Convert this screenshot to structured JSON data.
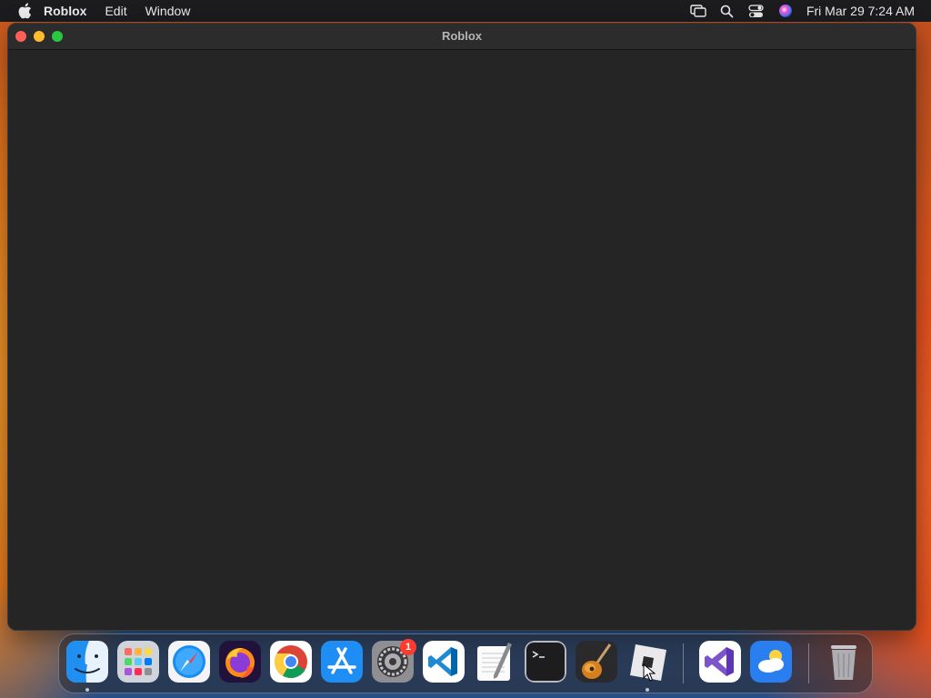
{
  "menubar": {
    "app_name": "Roblox",
    "items": [
      "Edit",
      "Window"
    ],
    "clock": "Fri Mar 29  7:24 AM",
    "status_icons": [
      "screen-mirroring-icon",
      "search-icon",
      "control-center-icon",
      "siri-icon"
    ]
  },
  "window": {
    "title": "Roblox"
  },
  "dock": {
    "apps": [
      {
        "name": "Finder",
        "icon": "finder-icon",
        "running": true
      },
      {
        "name": "Launchpad",
        "icon": "launchpad-icon",
        "running": false
      },
      {
        "name": "Safari",
        "icon": "safari-icon",
        "running": false
      },
      {
        "name": "Firefox",
        "icon": "firefox-icon",
        "running": false
      },
      {
        "name": "Google Chrome",
        "icon": "chrome-icon",
        "running": false
      },
      {
        "name": "App Store",
        "icon": "app-store-icon",
        "running": false
      },
      {
        "name": "System Settings",
        "icon": "system-settings-icon",
        "running": false,
        "badge": "1"
      },
      {
        "name": "Visual Studio Code",
        "icon": "vscode-icon",
        "running": false
      },
      {
        "name": "TextEdit",
        "icon": "textedit-icon",
        "running": false
      },
      {
        "name": "Terminal",
        "icon": "terminal-icon",
        "running": false
      },
      {
        "name": "GarageBand",
        "icon": "garageband-icon",
        "running": false
      },
      {
        "name": "Roblox",
        "icon": "roblox-icon",
        "running": true
      },
      {
        "name": "Visual Studio",
        "icon": "visual-studio-icon",
        "running": false
      },
      {
        "name": "Weather",
        "icon": "weather-icon",
        "running": false
      },
      {
        "name": "Trash",
        "icon": "trash-icon",
        "running": false
      }
    ]
  },
  "colors": {
    "menubar_bg": "#1c1c1e",
    "window_bg": "#252525",
    "close": "#fe5f57",
    "minimize": "#febc2e",
    "maximize": "#28c840",
    "badge": "#ff3b30"
  }
}
